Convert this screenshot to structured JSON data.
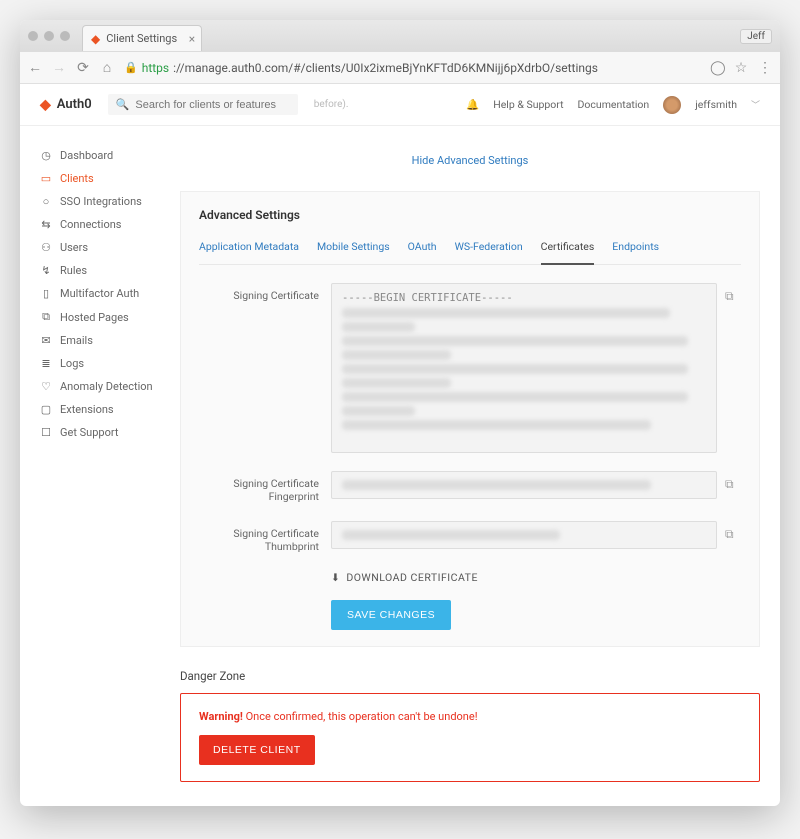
{
  "browser": {
    "tab_title": "Client Settings",
    "profile_badge": "Jeff",
    "url_https": "https",
    "url_rest": "://manage.auth0.com/#/clients/U0Ix2ixmeBjYnKFTdD6KMNijj6pXdrbO/settings"
  },
  "header": {
    "logo_text": "Auth0",
    "search_placeholder": "Search for clients or features",
    "hint_text": "before).",
    "help_label": "Help & Support",
    "docs_label": "Documentation",
    "username": "jeffsmith"
  },
  "sidebar": {
    "items": [
      {
        "icon": "◷",
        "label": "Dashboard"
      },
      {
        "icon": "▭",
        "label": "Clients"
      },
      {
        "icon": "○",
        "label": "SSO Integrations"
      },
      {
        "icon": "⇆",
        "label": "Connections"
      },
      {
        "icon": "⚇",
        "label": "Users"
      },
      {
        "icon": "↯",
        "label": "Rules"
      },
      {
        "icon": "▯",
        "label": "Multifactor Auth"
      },
      {
        "icon": "⧉",
        "label": "Hosted Pages"
      },
      {
        "icon": "✉",
        "label": "Emails"
      },
      {
        "icon": "≣",
        "label": "Logs"
      },
      {
        "icon": "♡",
        "label": "Anomaly Detection"
      },
      {
        "icon": "▢",
        "label": "Extensions"
      },
      {
        "icon": "☐",
        "label": "Get Support"
      }
    ],
    "active_index": 1
  },
  "content": {
    "hide_link": "Hide Advanced Settings",
    "card_title": "Advanced Settings",
    "tabs": [
      "Application Metadata",
      "Mobile Settings",
      "OAuth",
      "WS-Federation",
      "Certificates",
      "Endpoints"
    ],
    "active_tab_index": 4,
    "fields": {
      "signing_cert_label": "Signing Certificate",
      "signing_cert_header": "-----BEGIN CERTIFICATE-----",
      "fingerprint_label": "Signing Certificate Fingerprint",
      "thumbprint_label": "Signing Certificate Thumbprint"
    },
    "download_label": "DOWNLOAD CERTIFICATE",
    "save_label": "SAVE CHANGES"
  },
  "danger": {
    "title": "Danger Zone",
    "warn_strong": "Warning!",
    "warn_rest": " Once confirmed, this operation can't be undone!",
    "delete_label": "DELETE CLIENT"
  }
}
